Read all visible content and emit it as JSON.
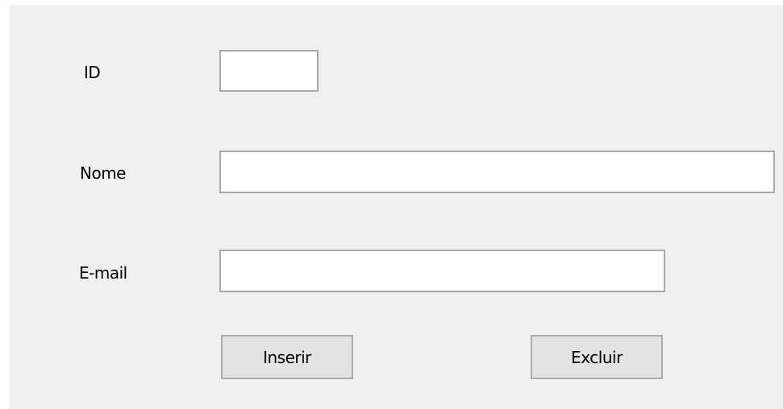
{
  "form": {
    "id_label": "ID",
    "id_value": "",
    "name_label": "Nome",
    "name_value": "",
    "email_label": "E-mail",
    "email_value": "",
    "insert_label": "Inserir",
    "delete_label": "Excluir"
  },
  "colors": {
    "panel_background": "#f0f0f0",
    "field_background": "#ffffff",
    "field_border": "#a8a8a8",
    "button_background": "#e3e3e3",
    "button_border": "#adadad"
  }
}
